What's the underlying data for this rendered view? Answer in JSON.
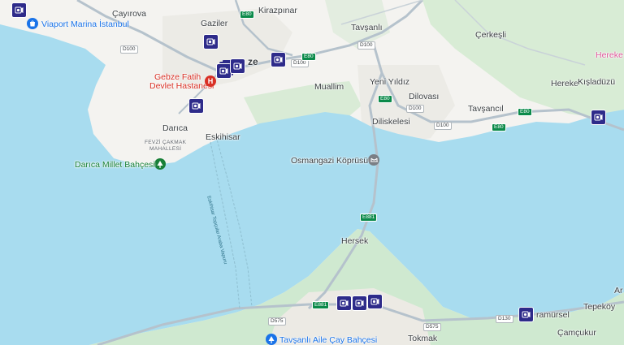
{
  "places": {
    "cayirova": "Çayırova",
    "gaziler": "Gaziler",
    "kirazpinar": "Kirazpınar",
    "tavsanli": "Tavşanlı",
    "cerkesli": "Çerkeşli",
    "hereke_top": "Hereke",
    "gebze_partial": "ze",
    "muallim": "Muallim",
    "yeni_yildiz": "Yeni Yıldız",
    "dilovasi": "Dilovası",
    "hereke": "Hereke",
    "kisladuzu": "Kışladüzü",
    "tavsancil": "Tavşancıl",
    "diliskelesi": "Diliskelesi",
    "darica": "Darıca",
    "eskihisar": "Eskihisar",
    "fevzi_cakmak": "FEVZİ ÇAKMAK\nMAHALLESİ",
    "hersek": "Hersek",
    "tokmak": "Tokmak",
    "karamursel_partial": "ramürsel",
    "tepekoy": "Tepeköy",
    "camcukur": "Çamçukur",
    "ar_partial": "Ar"
  },
  "pois": {
    "viaport": "Viaport Marina İstanbul",
    "hospital_line1": "Gebze Fatih",
    "hospital_line2": "Devlet Hastanesi",
    "darica_park": "Darıca Millet Bahçesi",
    "bridge": "Osmangazi Köprüsü",
    "tavsanli_park": "Tavşanlı Aile Çay Bahçesi"
  },
  "ferry_label": "Eskihisar Topçular Araba Vapuru",
  "roads": {
    "d100_1": "D100",
    "d100_2": "D100",
    "d100_3": "D100",
    "d100_4": "D100",
    "d100_5": "D100",
    "e80_1": "E80",
    "e80_2": "E80",
    "e80_3": "E80",
    "e80_4": "E80",
    "e80_5": "E80",
    "e881_1": "E881",
    "e881_2": "E881",
    "d575_1": "D575",
    "d575_2": "D575",
    "d130": "D130"
  },
  "hospital_letter": "H",
  "colors": {
    "water": "#a8dcef",
    "land": "#f4f3f0",
    "urban": "#eceae4",
    "green": "#cfe9d0",
    "highway": "#b5c2cc",
    "camera": "#2e2b8a",
    "poi_blue": "#1a73e8",
    "hospital_red": "#d93025"
  },
  "icons": {
    "camera": "speed-camera-icon",
    "viaport": "shopping-bag-icon",
    "hospital": "hospital-icon",
    "park": "park-tree-icon",
    "bridge": "bridge-icon"
  }
}
